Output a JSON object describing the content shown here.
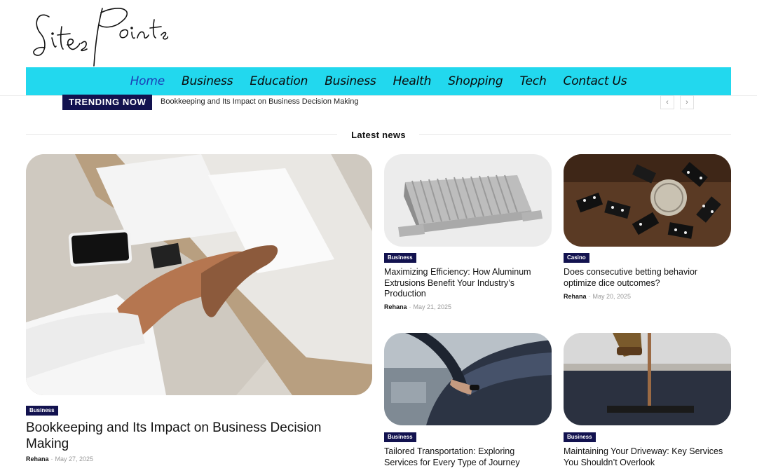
{
  "logo": {
    "text": "Sites Points"
  },
  "nav": {
    "items": [
      "Home",
      "Business",
      "Education",
      "Business",
      "Health",
      "Shopping",
      "Tech",
      "Contact Us"
    ],
    "active_index": 0
  },
  "trending": {
    "label": "TRENDING NOW",
    "headline": "Bookkeeping and Its Impact on Business Decision Making",
    "prev_icon": "chevron-left-icon",
    "next_icon": "chevron-right-icon"
  },
  "section": {
    "title": "Latest news"
  },
  "featured": {
    "category": "Business",
    "title": "Bookkeeping and Its Impact on Business Decision Making",
    "author": "Rehana",
    "date": "May 27, 2025",
    "image": "handshake-photo"
  },
  "posts": [
    {
      "category": "Business",
      "title": "Maximizing Efficiency: How Aluminum Extrusions Benefit Your Industry’s Production",
      "author": "Rehana",
      "date": "May 21, 2025",
      "image": "aluminum-extrusion-photo"
    },
    {
      "category": "Casino",
      "title": "Does consecutive betting behavior optimize dice outcomes?",
      "author": "Rehana",
      "date": "May 20, 2025",
      "image": "dominoes-bitcoin-photo"
    },
    {
      "category": "Business",
      "title": "Tailored Transportation: Exploring Services for Every Type of Journey",
      "image": "car-door-photo"
    },
    {
      "category": "Business",
      "title": "Maintaining Your Driveway: Key Services You Shouldn’t Overlook",
      "image": "asphalt-paving-photo"
    }
  ],
  "colors": {
    "nav_bg": "#22d8ee",
    "badge_bg": "#12124f",
    "active_link": "#1b3fb7"
  }
}
